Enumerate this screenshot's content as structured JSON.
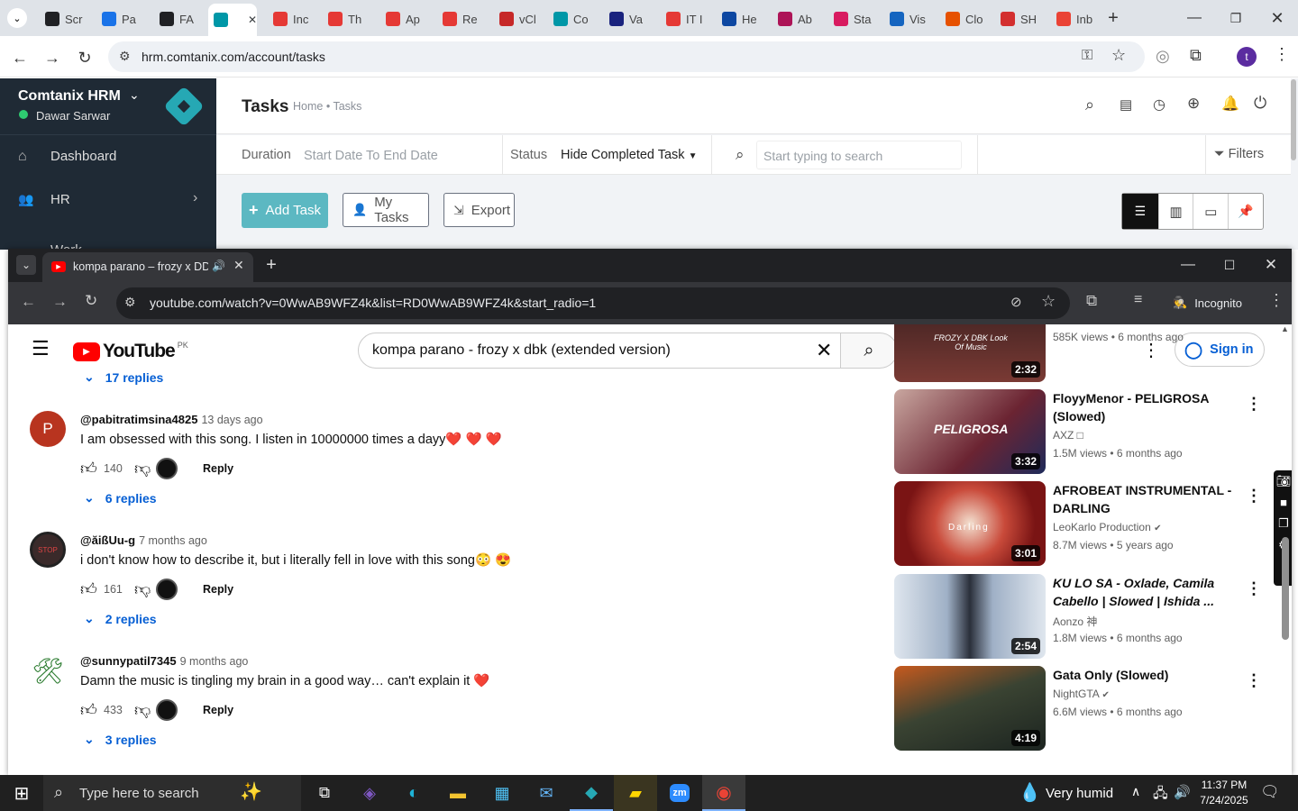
{
  "outer_tabs": [
    {
      "label": "Scr",
      "color": "#202124"
    },
    {
      "label": "Pa",
      "color": "#1a73e8"
    },
    {
      "label": "FA",
      "color": "#202124"
    },
    {
      "label": "",
      "color": "#0097a7"
    },
    {
      "label": "Inc",
      "color": "#e53935"
    },
    {
      "label": "Th",
      "color": "#e53935"
    },
    {
      "label": "Ap",
      "color": "#e53935"
    },
    {
      "label": "Re",
      "color": "#e53935"
    },
    {
      "label": "vCl",
      "color": "#c62828"
    },
    {
      "label": "Co",
      "color": "#0097a7"
    },
    {
      "label": "Va",
      "color": "#1a237e"
    },
    {
      "label": "IT I",
      "color": "#e53935"
    },
    {
      "label": "He",
      "color": "#0d47a1"
    },
    {
      "label": "Ab",
      "color": "#ad1457"
    },
    {
      "label": "Sta",
      "color": "#d81b60"
    },
    {
      "label": "Vis",
      "color": "#1565c0"
    },
    {
      "label": "Clo",
      "color": "#e65100"
    },
    {
      "label": "SH",
      "color": "#d32f2f"
    },
    {
      "label": "Inb",
      "color": "#ea4335"
    }
  ],
  "outer_url": "hrm.comtanix.com/account/tasks",
  "outer_profile": "t",
  "hrm": {
    "brand": "Comtanix HRM",
    "user": "Dawar Sarwar",
    "nav": [
      "Dashboard",
      "HR",
      "Work"
    ],
    "page_title": "Tasks",
    "breadcrumb": "Home • Tasks",
    "duration_label": "Duration",
    "duration_value": "Start Date To End Date",
    "status_label": "Status",
    "status_value": "Hide Completed Task",
    "search_placeholder": "Start typing to search",
    "filters": "Filters",
    "add_task": "Add Task",
    "my_tasks": "My Tasks",
    "export": "Export"
  },
  "inner": {
    "tab_title": "kompa parano – frozy x DD",
    "url": "youtube.com/watch?v=0WwAB9WFZ4k&list=RD0WwAB9WFZ4k&start_radio=1",
    "incognito": "Incognito"
  },
  "youtube": {
    "logo": "YouTube",
    "region": "PK",
    "search_query": "kompa parano - frozy x dbk (extended version)",
    "sign_in": "Sign in",
    "top_replies": "17 replies",
    "comments": [
      {
        "handle": "@pabitratimsina4825",
        "ago": "13 days ago",
        "text": "I am obsessed with this song. I listen in 10000000 times a dayy❤️ ❤️ ❤️",
        "likes": "140",
        "reply": "Reply",
        "replies": "6 replies",
        "avatar_letter": "P",
        "avatar_color": "#b8341f"
      },
      {
        "handle": "@ăißUu-g",
        "ago": "7 months ago",
        "text": "i don't know how to describe it, but i literally fell in love with this song😳 😍",
        "likes": "161",
        "reply": "Reply",
        "replies": "2 replies",
        "avatar_letter": "STOP",
        "avatar_color": "#3a2a2a"
      },
      {
        "handle": "@sunnypatil7345",
        "ago": "9 months ago",
        "text": "Damn the music is tingling my brain in a good way… can't explain it ❤️",
        "likes": "433",
        "reply": "Reply",
        "replies": "3 replies",
        "avatar_letter": "🛠",
        "avatar_color": "#ffffff"
      }
    ],
    "related": [
      {
        "title": "",
        "channel": "",
        "meta": "585K views • 6 months ago",
        "duration": "2:32",
        "thumb": "#5a2a2a",
        "thumb_text": "FROZY X DBK Look Of Music"
      },
      {
        "title": "FloyyMenor - PELIGROSA (Slowed)",
        "channel": "AXZ □",
        "meta": "1.5M views • 6 months ago",
        "duration": "3:32",
        "thumb": "#7b2b3a",
        "thumb_text": "PELIGROSA"
      },
      {
        "title": "AFROBEAT INSTRUMENTAL - DARLING",
        "channel": "LeoKarlo Production",
        "meta": "8.7M views • 5 years ago",
        "duration": "3:01",
        "thumb": "#8b1e1e",
        "thumb_text": "Darling"
      },
      {
        "title": "KU LO SA - Oxlade, Camila Cabello | Slowed | Ishida ...",
        "channel": "Aonzo 神",
        "meta": "1.8M views • 6 months ago",
        "duration": "2:54",
        "thumb": "#9aa7b8",
        "thumb_text": ""
      },
      {
        "title": "Gata Only (Slowed)",
        "channel": "NightGTA",
        "meta": "6.6M views • 6 months ago",
        "duration": "4:19",
        "thumb": "#3d4a3a",
        "thumb_text": ""
      }
    ]
  },
  "taskbar": {
    "search_placeholder": "Type here to search",
    "weather": "Very humid",
    "time": "11:37 PM",
    "date": "7/24/2025"
  }
}
